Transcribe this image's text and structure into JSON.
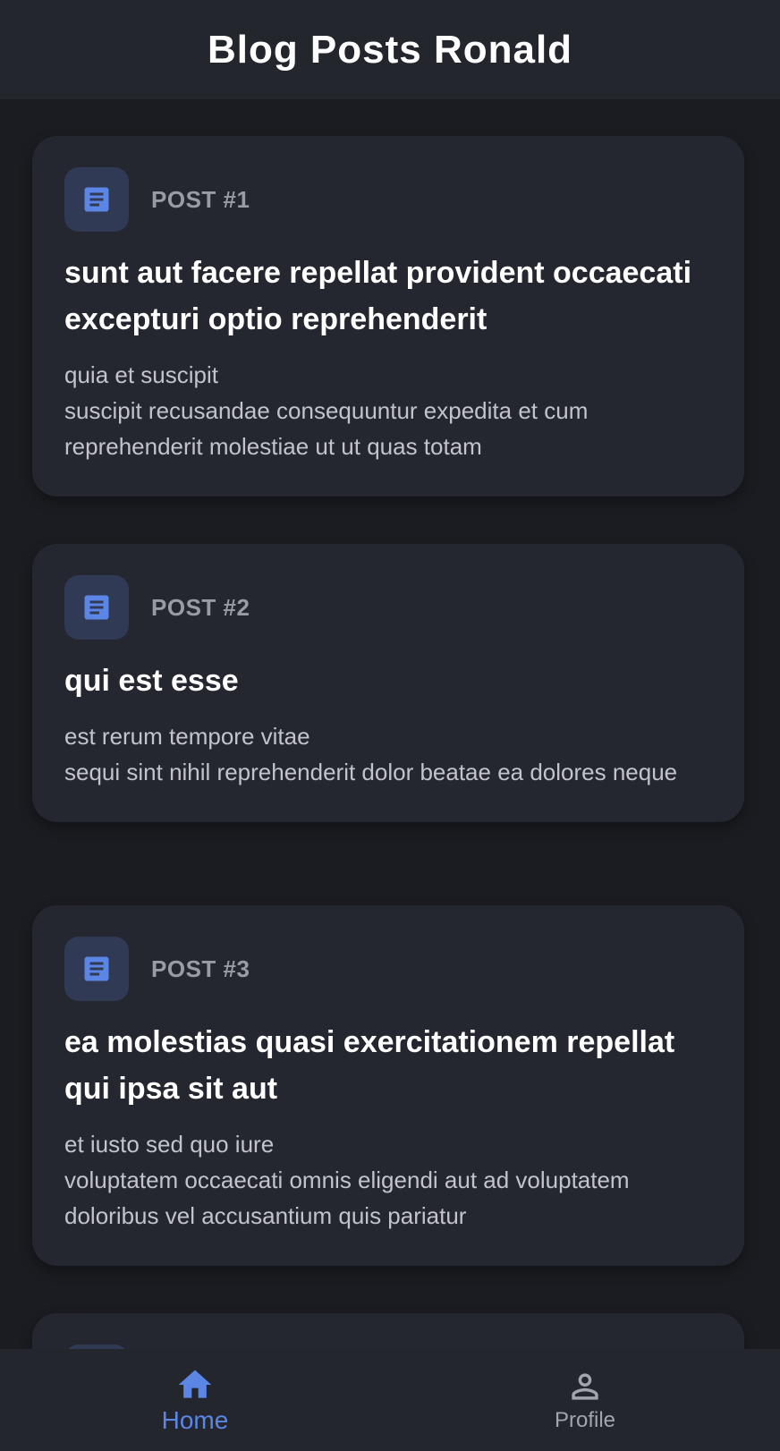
{
  "app_bar": {
    "title": "Blog Posts Ronald"
  },
  "posts": [
    {
      "number_label": "POST #1",
      "title": "sunt aut facere repellat provident occaecati excepturi optio reprehenderit",
      "body": "quia et suscipit\nsuscipit recusandae consequuntur expedita et cum reprehenderit molestiae ut ut quas totam",
      "icon": "article-icon"
    },
    {
      "number_label": "POST #2",
      "title": "qui est esse",
      "body": "est rerum tempore vitae\nsequi sint nihil reprehenderit dolor beatae ea dolores neque",
      "icon": "article-icon"
    },
    {
      "number_label": "POST #3",
      "title": "ea molestias quasi exercitationem repellat qui ipsa sit aut",
      "body": "et iusto sed quo iure\nvoluptatem occaecati omnis eligendi aut ad voluptatem doloribus vel accusantium quis pariatur",
      "icon": "article-icon"
    }
  ],
  "bottom_nav": {
    "items": [
      {
        "label": "Home",
        "icon": "home-icon",
        "selected": true
      },
      {
        "label": "Profile",
        "icon": "person-icon",
        "selected": false
      }
    ]
  },
  "colors": {
    "background": "#1b1c21",
    "surface": "#252730",
    "accent": "#5b86e6",
    "icon_badge": "#303a55"
  }
}
